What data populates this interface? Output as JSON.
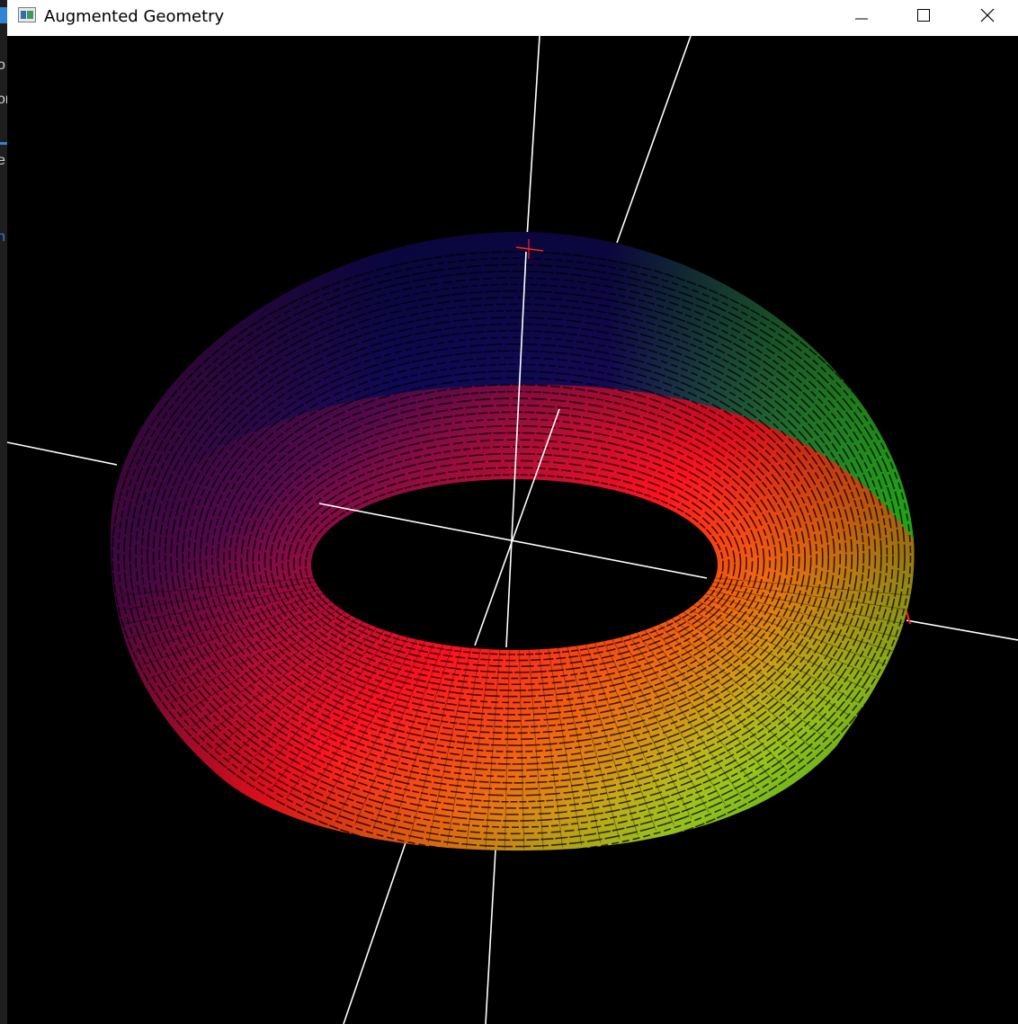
{
  "window": {
    "title": "Augmented Geometry",
    "icon": "app-window-icon",
    "controls": [
      "minimize-icon",
      "maximize-icon",
      "close-icon"
    ]
  },
  "background_window": {
    "fragments": [
      "o",
      "or",
      "e",
      "n"
    ],
    "accent_color": "#2f84d6"
  },
  "scene": {
    "object": "torus",
    "background_color": "#000000",
    "axis_color": "#ffffff",
    "origin_marker_color": "#ff2020",
    "gradient_colors": {
      "blue": "#0a0a60",
      "purple": "#5a0a50",
      "red": "#ff1020",
      "orange": "#f06a10",
      "yellow_green": "#a8d820",
      "green": "#20e820"
    }
  }
}
